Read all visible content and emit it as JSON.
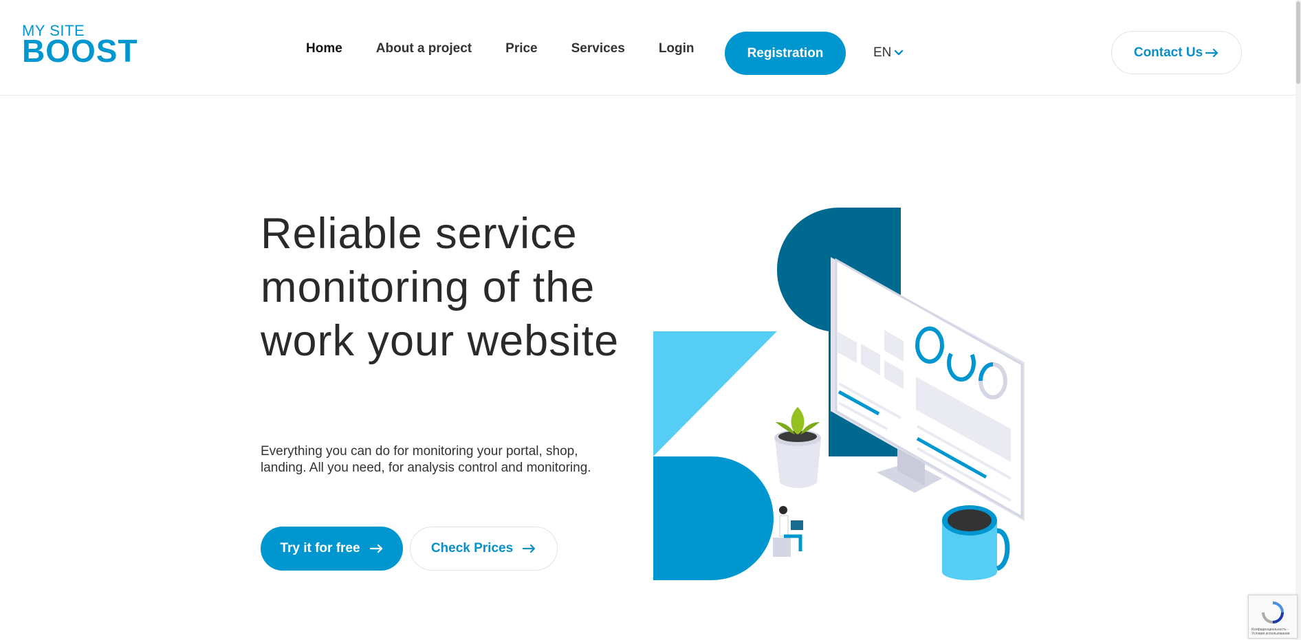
{
  "logo": {
    "top_text": "MY SITE",
    "bottom_text": "BOOST",
    "brand_color": "#0097d1"
  },
  "nav": {
    "items": [
      {
        "label": "Home",
        "active": true
      },
      {
        "label": "About a project"
      },
      {
        "label": "Price"
      },
      {
        "label": "Services"
      },
      {
        "label": "Login"
      }
    ],
    "registration_label": "Registration",
    "language": "EN",
    "contact_label": "Contact Us"
  },
  "hero": {
    "title": "Reliable service monitoring of the work your website",
    "description": "Everything you can do for monitoring your portal, shop, landing. All you need, for analysis control and monitoring.",
    "try_label": "Try it for free",
    "check_label": "Check Prices"
  },
  "recaptcha": {
    "text": "Конфиденциальность - Условия использования"
  },
  "colors": {
    "accent": "#0097d1",
    "dark_teal": "#00698f",
    "light_cyan": "#56cdf4",
    "text": "#2a2a2a"
  }
}
